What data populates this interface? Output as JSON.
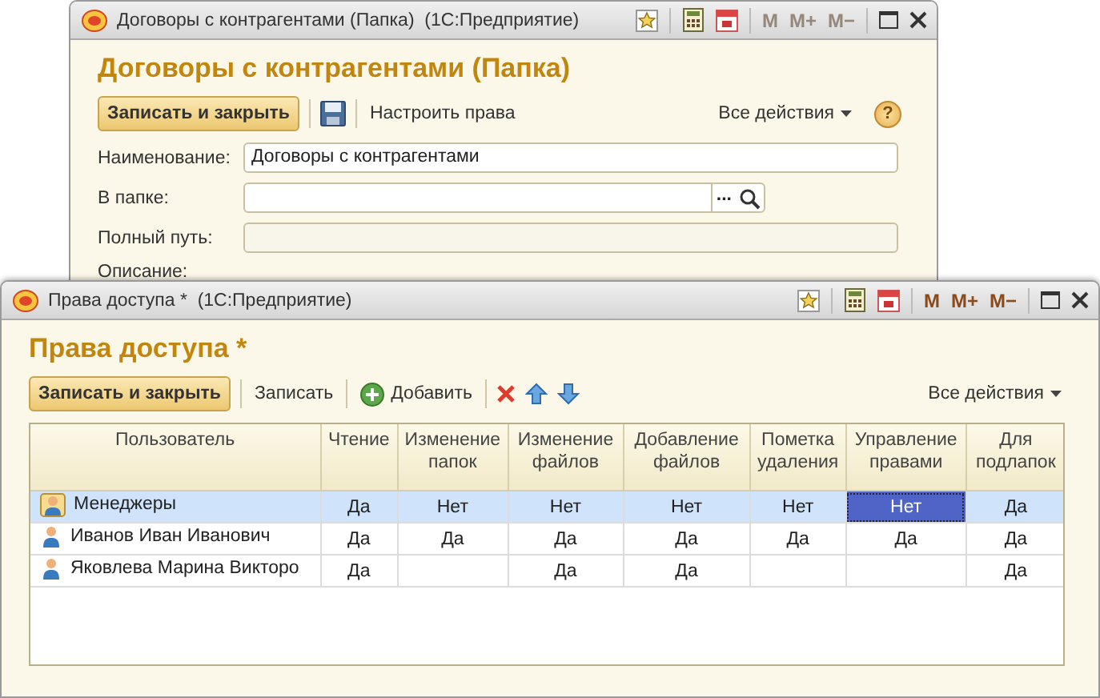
{
  "back_window": {
    "title": "Договоры с контрагентами (Папка)  (1С:Предприятие)",
    "memory_buttons": [
      {
        "label": "M",
        "disabled": true
      },
      {
        "label": "M+",
        "disabled": true
      },
      {
        "label": "M−",
        "disabled": true
      }
    ],
    "heading": "Договоры с контрагентами (Папка)",
    "toolbar": {
      "primary": "Записать и закрыть",
      "link": "Настроить права",
      "all_actions": "Все действия",
      "help": "?"
    },
    "fields": [
      {
        "kind": "text",
        "label": "Наименование:",
        "value": "Договоры с контрагентами"
      },
      {
        "kind": "choice",
        "label": "В папке:",
        "button": "..."
      },
      {
        "kind": "readonly",
        "label": "Полный путь:"
      },
      {
        "kind": "label",
        "label": "Описание:"
      }
    ]
  },
  "front_window": {
    "title": "Права доступа *  (1С:Предприятие)",
    "memory_buttons": [
      {
        "label": "M",
        "disabled": false
      },
      {
        "label": "M+",
        "disabled": false
      },
      {
        "label": "M−",
        "disabled": false
      }
    ],
    "heading": "Права доступа *",
    "toolbar": {
      "primary": "Записать и закрыть",
      "save": "Записать",
      "add": "Добавить",
      "all_actions": "Все действия"
    },
    "table": {
      "columns": [
        "Пользователь",
        "Чтение",
        "Изменение папок",
        "Изменение файлов",
        "Добавление файлов",
        "Пометка удаления",
        "Управление правами",
        "Для подлапок"
      ],
      "rows": [
        {
          "kind": "group",
          "selected": true,
          "cells": [
            {
              "value": "Менеджеры",
              "focused": false
            },
            {
              "value": "Да",
              "focused": false
            },
            {
              "value": "Нет",
              "focused": false
            },
            {
              "value": "Нет",
              "focused": false
            },
            {
              "value": "Нет",
              "focused": false
            },
            {
              "value": "Нет",
              "focused": false
            },
            {
              "value": "Нет",
              "focused": true
            },
            {
              "value": "Да",
              "focused": false
            }
          ]
        },
        {
          "kind": "user",
          "selected": false,
          "cells": [
            {
              "value": "Иванов Иван Иванович",
              "focused": false
            },
            {
              "value": "Да",
              "focused": false
            },
            {
              "value": "Да",
              "focused": false
            },
            {
              "value": "Да",
              "focused": false
            },
            {
              "value": "Да",
              "focused": false
            },
            {
              "value": "Да",
              "focused": false
            },
            {
              "value": "Да",
              "focused": false
            },
            {
              "value": "Да",
              "focused": false
            }
          ]
        },
        {
          "kind": "user",
          "selected": false,
          "cells": [
            {
              "value": "Яковлева Марина Викторо",
              "focused": false
            },
            {
              "value": "Да",
              "focused": false
            },
            {
              "focused": false
            },
            {
              "value": "Да",
              "focused": false
            },
            {
              "value": "Да",
              "focused": false
            },
            {
              "focused": false
            },
            {
              "focused": false
            },
            {
              "value": "Да",
              "focused": false
            }
          ]
        }
      ]
    }
  }
}
